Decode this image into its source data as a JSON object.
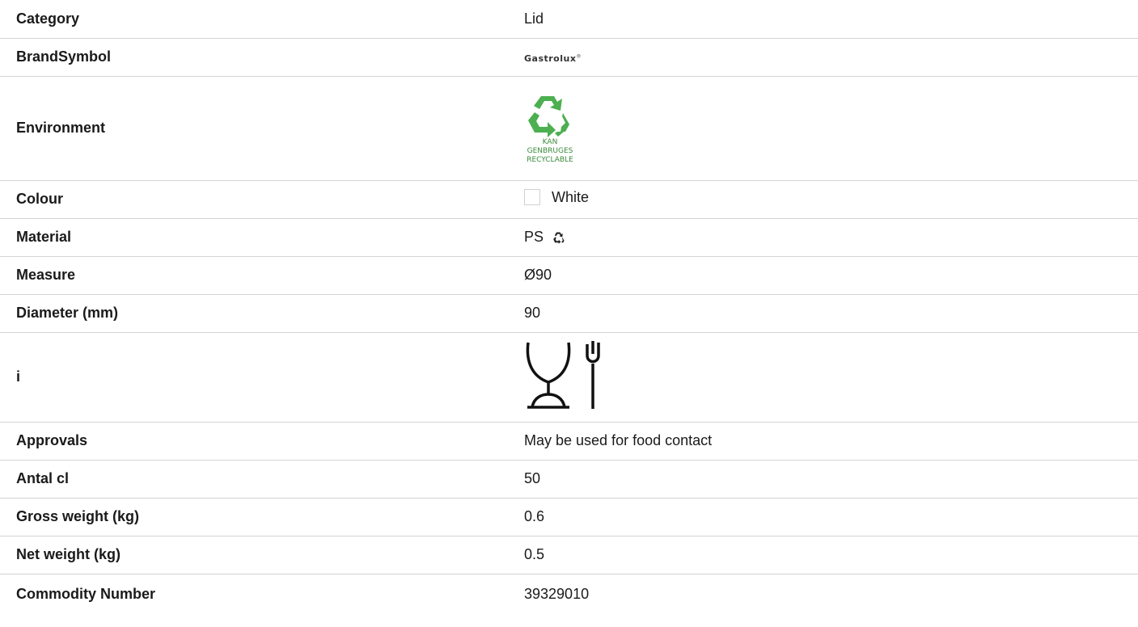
{
  "rows": {
    "category": {
      "label": "Category",
      "value": "Lid"
    },
    "brand": {
      "label": "BrandSymbol",
      "value": "Gastrolux",
      "mark": "®"
    },
    "environment": {
      "label": "Environment",
      "icon": "recycle-icon",
      "lines": [
        "KAN",
        "GENBRUGES",
        "RECYCLABLE"
      ],
      "color": "#4caf50"
    },
    "colour": {
      "label": "Colour",
      "value": "White",
      "swatch": "#ffffff"
    },
    "material": {
      "label": "Material",
      "value": "PS",
      "icon": "recycle-small-icon"
    },
    "measure": {
      "label": "Measure",
      "value": "Ø90"
    },
    "diameter": {
      "label": "Diameter (mm)",
      "value": "90"
    },
    "info": {
      "label": "i",
      "icon": "food-safe-glass-fork-icon"
    },
    "approvals": {
      "label": "Approvals",
      "value": "May be used for food contact"
    },
    "antal": {
      "label": "Antal cl",
      "value": "50"
    },
    "gross": {
      "label": "Gross weight (kg)",
      "value": "0.6"
    },
    "net": {
      "label": "Net weight (kg)",
      "value": "0.5"
    },
    "commodity": {
      "label": "Commodity Number",
      "value": "39329010"
    }
  }
}
